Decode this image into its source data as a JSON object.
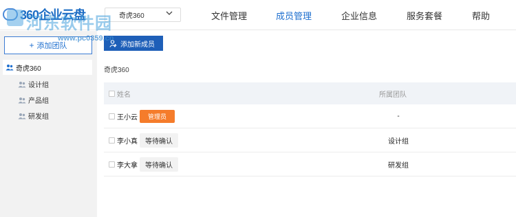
{
  "header": {
    "logo_text": "360企业云盘",
    "org_select": "奇虎360",
    "nav": [
      {
        "label": "文件管理",
        "active": false
      },
      {
        "label": "成员管理",
        "active": true
      },
      {
        "label": "企业信息",
        "active": false
      },
      {
        "label": "服务套餐",
        "active": false
      },
      {
        "label": "帮助",
        "active": false
      }
    ]
  },
  "watermark": {
    "text": "河东软件园",
    "url": "www.pc0359.cn"
  },
  "sidebar": {
    "add_team_label": "添加团队",
    "root": "奇虎360",
    "teams": [
      "设计组",
      "产品组",
      "研发组"
    ]
  },
  "main": {
    "add_member_label": "添加新成员",
    "breadcrumb": "奇虎360",
    "columns": {
      "name": "姓名",
      "team": "所属团队"
    },
    "rows": [
      {
        "name": "王小云",
        "badge": "管理员",
        "badge_type": "admin",
        "team": "-"
      },
      {
        "name": "李小真",
        "badge": "等待确认",
        "badge_type": "pending",
        "team": "设计组"
      },
      {
        "name": "李大拿",
        "badge": "等待确认",
        "badge_type": "pending",
        "team": "研发组"
      }
    ]
  },
  "colors": {
    "accent": "#1e6fcf",
    "button": "#1e5fb8",
    "admin_badge": "#f57c2b",
    "sidebar_bg": "#f2f2f2"
  }
}
